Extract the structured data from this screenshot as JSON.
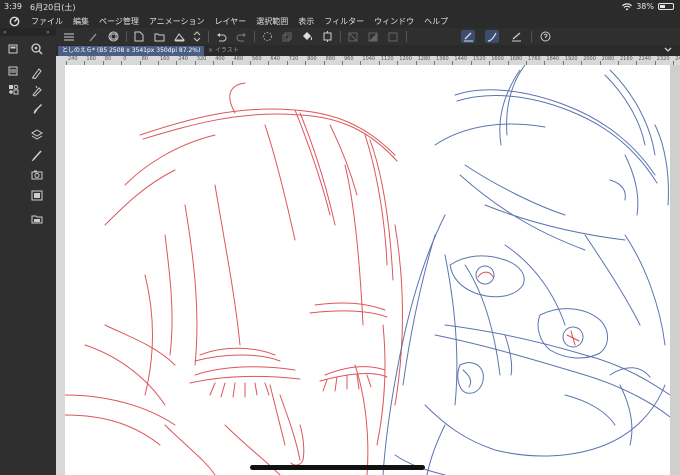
{
  "status": {
    "time": "3:39",
    "date": "6月20日(土)",
    "battery": "38%",
    "battery_level": 0.38
  },
  "menu": {
    "items": [
      "ファイル",
      "編集",
      "ページ管理",
      "アニメーション",
      "レイヤー",
      "選択範囲",
      "表示",
      "フィルター",
      "ウィンドウ",
      "ヘルプ"
    ]
  },
  "tabs": {
    "active": "としのえら* (B5 2508 x 3541px 350dpi 87.2%)",
    "inactive": "× イラスト"
  },
  "ruler": {
    "top": [
      "240",
      "160",
      "80",
      "0",
      "80",
      "160",
      "240",
      "320",
      "400",
      "480",
      "560",
      "640",
      "720",
      "800",
      "880",
      "960",
      "1040",
      "1120",
      "1200",
      "1280",
      "1360",
      "1440",
      "1520",
      "1600",
      "1680",
      "1760",
      "1840",
      "1920",
      "2000",
      "2080",
      "2160",
      "2240",
      "2320",
      "2400"
    ]
  },
  "colors": {
    "red_sketch": "#d8383f",
    "blue_sketch": "#4a66a8",
    "ui_dark": "#2b2b2b",
    "tab_active": "#4b5f86"
  }
}
